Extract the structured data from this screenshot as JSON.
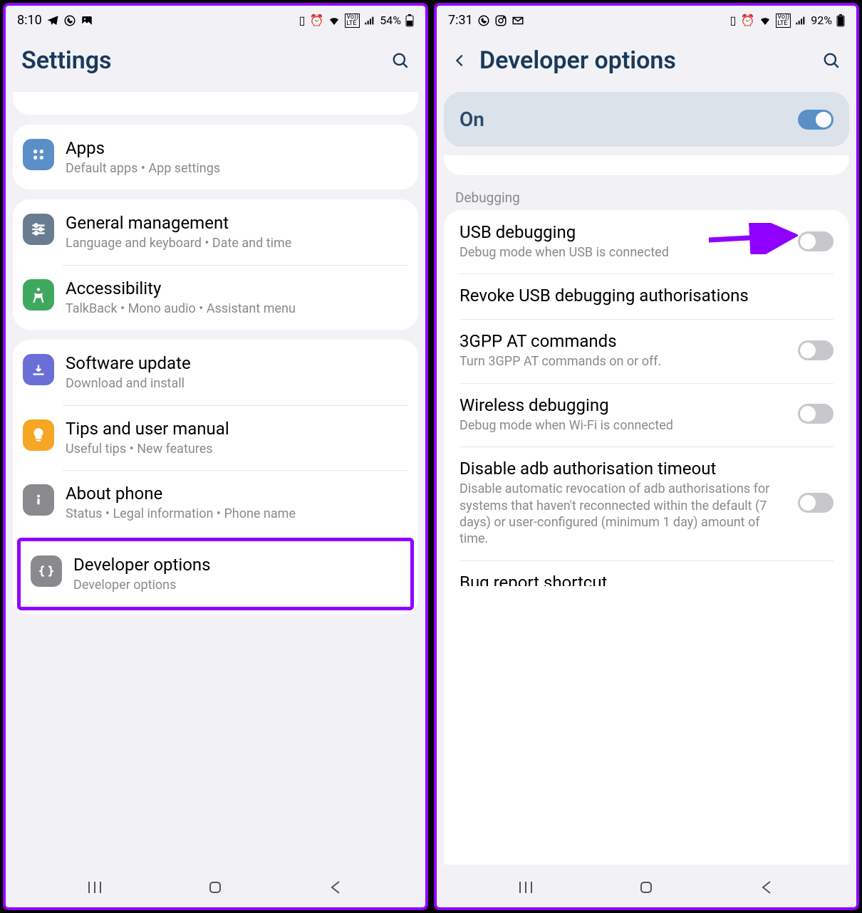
{
  "left": {
    "status": {
      "time": "8:10",
      "battery": "54%"
    },
    "header": {
      "title": "Settings"
    },
    "groups": [
      {
        "rows": [
          {
            "icon": "apps",
            "iconColor": "#5b8fc7",
            "title": "Apps",
            "sub": "Default apps  •  App settings"
          }
        ]
      },
      {
        "rows": [
          {
            "icon": "sliders",
            "iconColor": "#6a7d90",
            "title": "General management",
            "sub": "Language and keyboard  •  Date and time"
          },
          {
            "icon": "accessibility",
            "iconColor": "#3fa85f",
            "title": "Accessibility",
            "sub": "TalkBack  •  Mono audio  •  Assistant menu"
          }
        ]
      },
      {
        "rows": [
          {
            "icon": "update",
            "iconColor": "#6a6fd8",
            "title": "Software update",
            "sub": "Download and install"
          },
          {
            "icon": "tips",
            "iconColor": "#f5a623",
            "title": "Tips and user manual",
            "sub": "Useful tips  •  New features"
          },
          {
            "icon": "info",
            "iconColor": "#8a8a8e",
            "title": "About phone",
            "sub": "Status  •  Legal information  •  Phone name"
          },
          {
            "icon": "dev",
            "iconColor": "#8a8a8e",
            "title": "Developer options",
            "sub": "Developer options",
            "highlight": true
          }
        ]
      }
    ]
  },
  "right": {
    "status": {
      "time": "7:31",
      "battery": "92%"
    },
    "header": {
      "title": "Developer options"
    },
    "master": {
      "label": "On",
      "on": true
    },
    "section": "Debugging",
    "items": [
      {
        "title": "USB debugging",
        "sub": "Debug mode when USB is connected",
        "toggle": false,
        "arrow": true
      },
      {
        "title": "Revoke USB debugging authorisations",
        "sub": ""
      },
      {
        "title": "3GPP AT commands",
        "sub": "Turn 3GPP AT commands on or off.",
        "toggle": false
      },
      {
        "title": "Wireless debugging",
        "sub": "Debug mode when Wi-Fi is connected",
        "toggle": false
      },
      {
        "title": "Disable adb authorisation timeout",
        "sub": "Disable automatic revocation of adb authorisations for systems that haven't reconnected within the default (7 days) or user-configured (minimum 1 day) amount of time.",
        "toggle": false
      },
      {
        "title": "Bug report shortcut",
        "sub": "",
        "cut": true
      }
    ]
  }
}
